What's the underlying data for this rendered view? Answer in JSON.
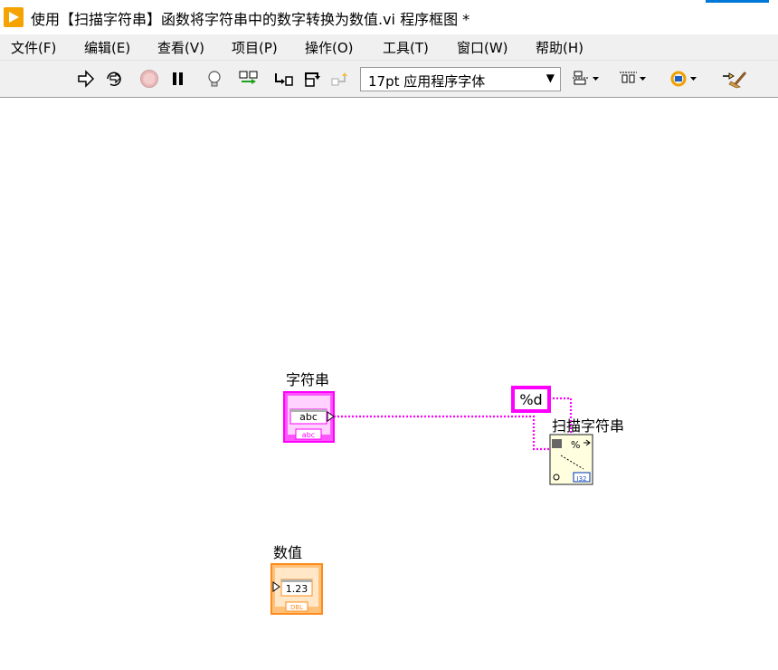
{
  "window": {
    "title": "使用【扫描字符串】函数将字符串中的数字转换为数值.vi 程序框图 *"
  },
  "menu": [
    {
      "label": "文件(F)"
    },
    {
      "label": "编辑(E)"
    },
    {
      "label": "查看(V)"
    },
    {
      "label": "项目(P)"
    },
    {
      "label": "操作(O)"
    },
    {
      "label": "工具(T)"
    },
    {
      "label": "窗口(W)"
    },
    {
      "label": "帮助(H)"
    }
  ],
  "toolbar": {
    "font_select_value": "17pt 应用程序字体"
  },
  "diagram": {
    "string_control": {
      "label": "字符串",
      "inner_text": "abc",
      "type_badge": "abc"
    },
    "format_constant": {
      "text": "%d"
    },
    "scan_function": {
      "label": "扫描字符串",
      "output_badge": "I32"
    },
    "number_indicator": {
      "label": "数值",
      "inner_text": "1.23",
      "type_badge": "DBL"
    },
    "colors": {
      "string_wire": "#ff00ff",
      "number": "#ff8c1a"
    }
  }
}
